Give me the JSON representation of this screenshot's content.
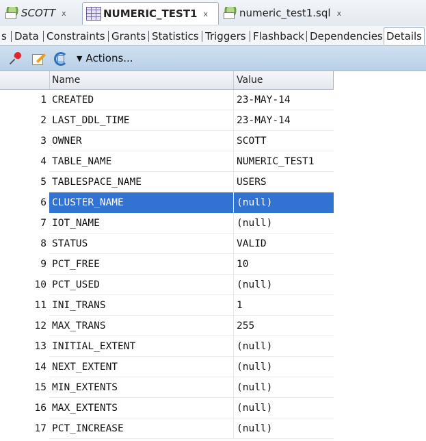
{
  "tabs": [
    {
      "label": "SCOTT",
      "close": "x"
    },
    {
      "label": "NUMERIC_TEST1",
      "close": "x"
    },
    {
      "label": "numeric_test1.sql",
      "close": "x"
    }
  ],
  "subtabs": [
    "s",
    "Data",
    "Constraints",
    "Grants",
    "Statistics",
    "Triggers",
    "Flashback",
    "Dependencies",
    "Details"
  ],
  "toolbar": {
    "actions_label": "Actions..."
  },
  "table": {
    "col_name": "Name",
    "col_value": "Value",
    "selected_row": 6,
    "rows": [
      {
        "n": "1",
        "name": "CREATED",
        "value": "23-MAY-14"
      },
      {
        "n": "2",
        "name": "LAST_DDL_TIME",
        "value": "23-MAY-14"
      },
      {
        "n": "3",
        "name": "OWNER",
        "value": "SCOTT"
      },
      {
        "n": "4",
        "name": "TABLE_NAME",
        "value": "NUMERIC_TEST1"
      },
      {
        "n": "5",
        "name": "TABLESPACE_NAME",
        "value": "USERS"
      },
      {
        "n": "6",
        "name": "CLUSTER_NAME",
        "value": "(null)"
      },
      {
        "n": "7",
        "name": "IOT_NAME",
        "value": "(null)"
      },
      {
        "n": "8",
        "name": "STATUS",
        "value": "VALID"
      },
      {
        "n": "9",
        "name": "PCT_FREE",
        "value": "10"
      },
      {
        "n": "10",
        "name": "PCT_USED",
        "value": "(null)"
      },
      {
        "n": "11",
        "name": "INI_TRANS",
        "value": "1"
      },
      {
        "n": "12",
        "name": "MAX_TRANS",
        "value": "255"
      },
      {
        "n": "13",
        "name": "INITIAL_EXTENT",
        "value": "(null)"
      },
      {
        "n": "14",
        "name": "NEXT_EXTENT",
        "value": "(null)"
      },
      {
        "n": "15",
        "name": "MIN_EXTENTS",
        "value": "(null)"
      },
      {
        "n": "16",
        "name": "MAX_EXTENTS",
        "value": "(null)"
      },
      {
        "n": "17",
        "name": "PCT_INCREASE",
        "value": "(null)"
      }
    ]
  }
}
